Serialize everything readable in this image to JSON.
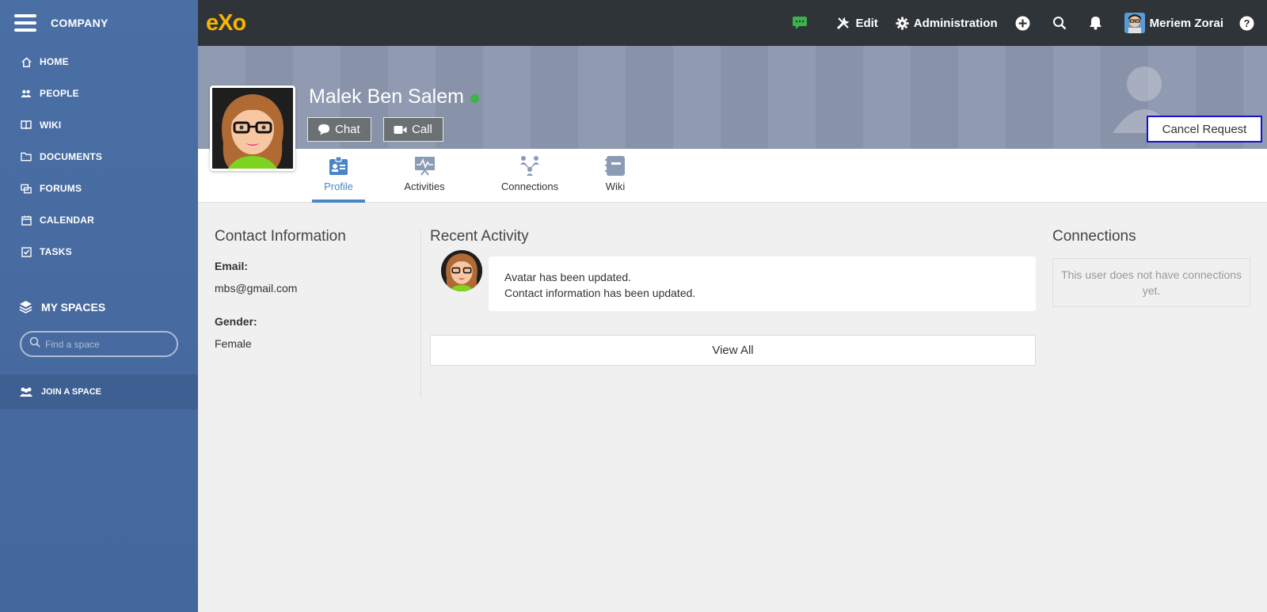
{
  "sidebar": {
    "company": "COMPANY",
    "nav": [
      {
        "label": "HOME",
        "icon": "home-icon"
      },
      {
        "label": "PEOPLE",
        "icon": "people-icon"
      },
      {
        "label": "WIKI",
        "icon": "book-icon"
      },
      {
        "label": "DOCUMENTS",
        "icon": "folder-icon"
      },
      {
        "label": "FORUMS",
        "icon": "forums-icon"
      },
      {
        "label": "CALENDAR",
        "icon": "calendar-icon"
      },
      {
        "label": "TASKS",
        "icon": "tasks-icon"
      }
    ],
    "my_spaces": "MY SPACES",
    "search_placeholder": "Find a space",
    "join_space": "JOIN A SPACE"
  },
  "topbar": {
    "logo": "eXo",
    "edit": "Edit",
    "administration": "Administration",
    "user_name": "Meriem Zorai"
  },
  "profile": {
    "name": "Malek Ben Salem",
    "chat_label": "Chat",
    "call_label": "Call",
    "cancel_request": "Cancel Request"
  },
  "tabs": [
    {
      "label": "Profile",
      "active": true
    },
    {
      "label": "Activities",
      "active": false
    },
    {
      "label": "Connections",
      "active": false
    },
    {
      "label": "Wiki",
      "active": false
    }
  ],
  "contact": {
    "title": "Contact Information",
    "email_label": "Email:",
    "email_value": "mbs@gmail.com",
    "gender_label": "Gender:",
    "gender_value": "Female"
  },
  "recent": {
    "title": "Recent Activity",
    "lines": [
      "Avatar has been updated.",
      "Contact information has been updated."
    ],
    "view_all": "View All"
  },
  "connections": {
    "title": "Connections",
    "empty_text": "This user does not have connections yet."
  },
  "colors": {
    "sidebar": "#4a6fa5",
    "topbar": "#2f3439",
    "accent": "#4a86c5",
    "logo": "#f7b500",
    "online": "#3bb34a"
  }
}
